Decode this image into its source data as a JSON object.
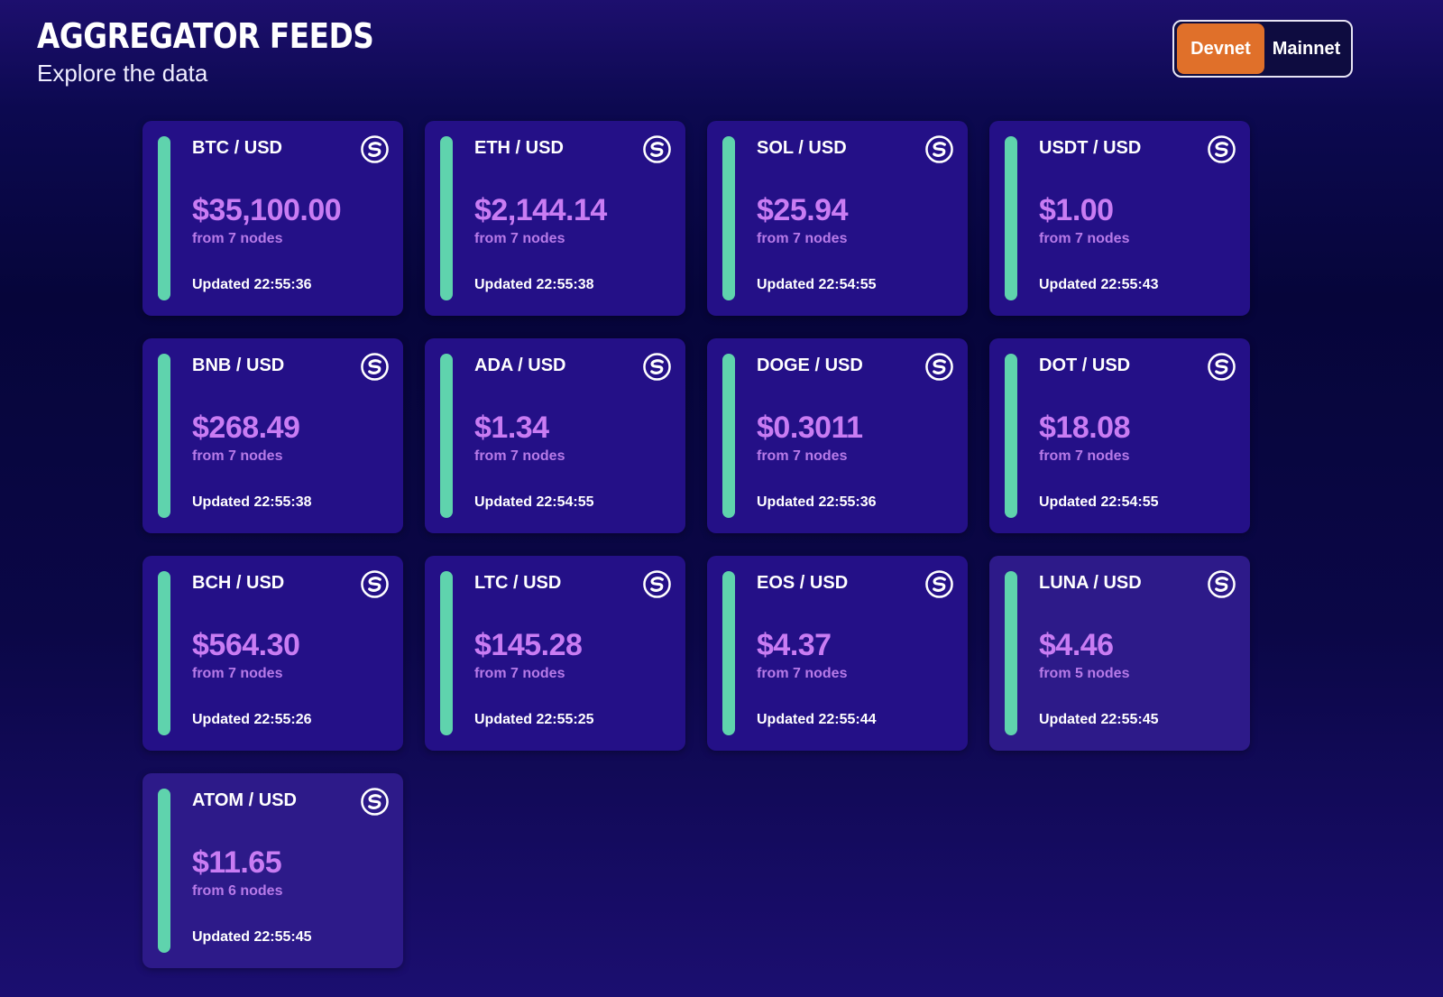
{
  "header": {
    "title": "AGGREGATOR FEEDS",
    "subtitle": "Explore the data"
  },
  "network_toggle": {
    "options": [
      "Devnet",
      "Mainnet"
    ],
    "selected": "Devnet"
  },
  "colors": {
    "active_toggle": "#e0702a",
    "accent_bar": "#5fd3ad",
    "price": "#c97cf3",
    "card_bg": "#241087"
  },
  "feeds": [
    {
      "pair": "BTC / USD",
      "price": "$35,100.00",
      "nodes": "from 7 nodes",
      "updated": "Updated 22:55:36",
      "icon": "switchboard-logo-icon"
    },
    {
      "pair": "ETH / USD",
      "price": "$2,144.14",
      "nodes": "from 7 nodes",
      "updated": "Updated 22:55:38",
      "icon": "switchboard-logo-icon"
    },
    {
      "pair": "SOL / USD",
      "price": "$25.94",
      "nodes": "from 7 nodes",
      "updated": "Updated 22:54:55",
      "icon": "switchboard-logo-icon"
    },
    {
      "pair": "USDT / USD",
      "price": "$1.00",
      "nodes": "from 7 nodes",
      "updated": "Updated 22:55:43",
      "icon": "switchboard-logo-icon"
    },
    {
      "pair": "BNB / USD",
      "price": "$268.49",
      "nodes": "from 7 nodes",
      "updated": "Updated 22:55:38",
      "icon": "switchboard-logo-icon"
    },
    {
      "pair": "ADA / USD",
      "price": "$1.34",
      "nodes": "from 7 nodes",
      "updated": "Updated 22:54:55",
      "icon": "switchboard-logo-icon"
    },
    {
      "pair": "DOGE / USD",
      "price": "$0.3011",
      "nodes": "from 7 nodes",
      "updated": "Updated 22:55:36",
      "icon": "switchboard-logo-icon"
    },
    {
      "pair": "DOT / USD",
      "price": "$18.08",
      "nodes": "from 7 nodes",
      "updated": "Updated 22:54:55",
      "icon": "switchboard-logo-icon"
    },
    {
      "pair": "BCH / USD",
      "price": "$564.30",
      "nodes": "from 7 nodes",
      "updated": "Updated 22:55:26",
      "icon": "switchboard-logo-icon"
    },
    {
      "pair": "LTC / USD",
      "price": "$145.28",
      "nodes": "from 7 nodes",
      "updated": "Updated 22:55:25",
      "icon": "switchboard-logo-icon"
    },
    {
      "pair": "EOS / USD",
      "price": "$4.37",
      "nodes": "from 7 nodes",
      "updated": "Updated 22:55:44",
      "icon": "switchboard-logo-icon"
    },
    {
      "pair": "LUNA / USD",
      "price": "$4.46",
      "nodes": "from 5 nodes",
      "updated": "Updated 22:55:45",
      "icon": "switchboard-logo-icon"
    },
    {
      "pair": "ATOM / USD",
      "price": "$11.65",
      "nodes": "from 6 nodes",
      "updated": "Updated 22:55:45",
      "icon": "switchboard-logo-icon"
    }
  ]
}
